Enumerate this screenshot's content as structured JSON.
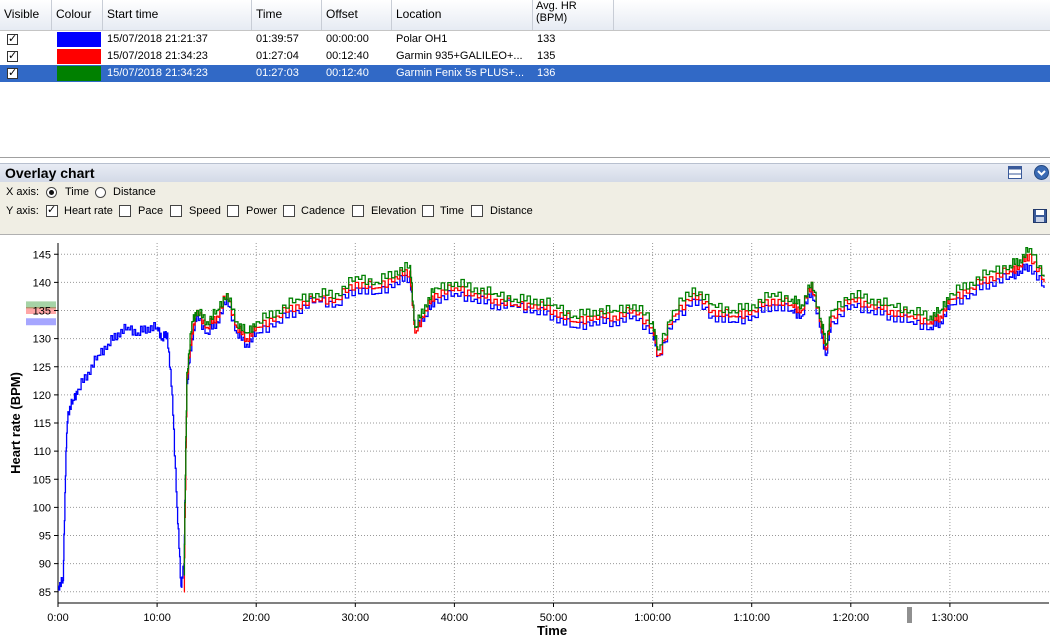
{
  "grid": {
    "columns": [
      "Visible",
      "Colour",
      "Start time",
      "Time",
      "Offset",
      "Location",
      "Avg. HR\n(BPM)"
    ],
    "rows": [
      {
        "visible": true,
        "color": "#0000ff",
        "start": "15/07/2018 21:21:37",
        "time": "01:39:57",
        "offset": "00:00:00",
        "location": "Polar OH1",
        "avg_hr": "133",
        "selected": false
      },
      {
        "visible": true,
        "color": "#ff0000",
        "start": "15/07/2018 21:34:23",
        "time": "01:27:04",
        "offset": "00:12:40",
        "location": "Garmin  935+GALILEO+...",
        "avg_hr": "135",
        "selected": false
      },
      {
        "visible": true,
        "color": "#008000",
        "start": "15/07/2018 21:34:23",
        "time": "01:27:03",
        "offset": "00:12:40",
        "location": "Garmin Fenix 5s PLUS+...",
        "avg_hr": "136",
        "selected": true
      }
    ]
  },
  "overlay": {
    "title": "Overlay chart",
    "x_axis_label": "X axis:",
    "x_options": [
      {
        "label": "Time",
        "checked": true
      },
      {
        "label": "Distance",
        "checked": false
      }
    ],
    "y_axis_label": "Y axis:",
    "y_options": [
      {
        "label": "Heart rate",
        "checked": true
      },
      {
        "label": "Pace",
        "checked": false
      },
      {
        "label": "Speed",
        "checked": false
      },
      {
        "label": "Power",
        "checked": false
      },
      {
        "label": "Cadence",
        "checked": false
      },
      {
        "label": "Elevation",
        "checked": false
      },
      {
        "label": "Time",
        "checked": false
      },
      {
        "label": "Distance",
        "checked": false
      }
    ]
  },
  "chart_data": {
    "type": "line",
    "xlabel": "Time",
    "ylabel": "Heart rate (BPM)",
    "xlim_min": [
      0,
      100
    ],
    "ylim": [
      83,
      147
    ],
    "x_ticks": [
      "0:00",
      "10:00",
      "20:00",
      "30:00",
      "40:00",
      "50:00",
      "1:00:00",
      "1:10:00",
      "1:20:00",
      "1:30:00"
    ],
    "y_ticks": [
      85,
      90,
      95,
      100,
      105,
      110,
      115,
      120,
      125,
      130,
      135,
      140,
      145
    ],
    "avg_markers": [
      133,
      135,
      136
    ],
    "series": [
      {
        "color": "#0000ff",
        "x": [
          0,
          0.5,
          0.8,
          1,
          1.5,
          2,
          3,
          4,
          5,
          6,
          7,
          8,
          9,
          10,
          10.5,
          11,
          11.5,
          12,
          12.4,
          12.7,
          13,
          13.5,
          14,
          15,
          16,
          17,
          18,
          19,
          20,
          22,
          24,
          26,
          28,
          30,
          32,
          34,
          35.5,
          36,
          37,
          38,
          40,
          42,
          44,
          46,
          48,
          50,
          52,
          54,
          56,
          58,
          60,
          60.5,
          62,
          64,
          66,
          68,
          70,
          72,
          74,
          75,
          76,
          77,
          77.5,
          78,
          80,
          82,
          84,
          86,
          88,
          89,
          90,
          92,
          94,
          96,
          97,
          98,
          99.5
        ],
        "y": [
          86,
          87,
          110,
          117,
          119,
          121,
          124,
          127,
          129,
          131,
          132,
          131,
          132,
          132,
          130,
          131,
          120,
          100,
          86,
          90,
          122,
          130,
          134,
          131,
          133,
          137,
          131,
          129,
          131,
          133,
          135,
          137,
          136,
          139,
          138,
          140,
          141,
          132,
          134,
          137,
          138,
          137,
          136,
          136,
          135,
          134,
          132,
          133,
          133,
          134,
          131,
          127,
          133,
          137,
          134,
          133,
          134,
          136,
          135,
          134,
          139,
          131,
          127,
          133,
          136,
          135,
          134,
          133,
          132,
          133,
          136,
          138,
          140,
          141,
          142,
          143,
          139
        ]
      },
      {
        "color": "#ff0000",
        "x": [
          12.7,
          13,
          13.5,
          14,
          15,
          16,
          17,
          18,
          19,
          20,
          22,
          24,
          26,
          28,
          30,
          32,
          34,
          35.5,
          36,
          37,
          38,
          40,
          42,
          44,
          46,
          48,
          50,
          52,
          54,
          56,
          58,
          60,
          60.5,
          62,
          64,
          66,
          68,
          70,
          72,
          74,
          75,
          76,
          77,
          77.5,
          78,
          80,
          82,
          84,
          86,
          88,
          89,
          90,
          92,
          94,
          96,
          97,
          98,
          99.5
        ],
        "y": [
          85,
          123,
          131,
          135,
          132,
          134,
          138,
          132,
          130,
          132,
          134,
          136,
          137,
          137,
          140,
          139,
          141,
          142,
          131,
          135,
          138,
          139,
          138,
          137,
          136,
          136,
          135,
          133,
          134,
          134,
          135,
          132,
          127,
          134,
          138,
          135,
          134,
          135,
          137,
          136,
          135,
          140,
          132,
          128,
          134,
          137,
          136,
          135,
          134,
          133,
          134,
          137,
          139,
          141,
          142,
          143,
          145,
          140
        ]
      },
      {
        "color": "#008000",
        "x": [
          12.7,
          13,
          13.5,
          14,
          15,
          16,
          17,
          18,
          19,
          20,
          22,
          24,
          26,
          28,
          30,
          32,
          34,
          35.5,
          36,
          37,
          38,
          40,
          42,
          44,
          46,
          48,
          50,
          52,
          54,
          56,
          58,
          60,
          60.5,
          62,
          64,
          66,
          68,
          70,
          72,
          74,
          75,
          76,
          77,
          77.5,
          78,
          80,
          82,
          84,
          86,
          88,
          89,
          90,
          92,
          94,
          96,
          97,
          98,
          99.5
        ],
        "y": [
          88,
          124,
          133,
          135,
          133,
          135,
          138,
          133,
          131,
          133,
          135,
          137,
          138,
          138,
          141,
          140,
          142,
          143,
          132,
          136,
          139,
          140,
          139,
          138,
          137,
          137,
          136,
          134,
          135,
          135,
          136,
          133,
          128,
          135,
          139,
          136,
          135,
          136,
          138,
          137,
          136,
          140,
          133,
          129,
          135,
          138,
          137,
          136,
          135,
          134,
          135,
          138,
          140,
          142,
          143,
          144,
          146,
          141
        ]
      }
    ]
  }
}
